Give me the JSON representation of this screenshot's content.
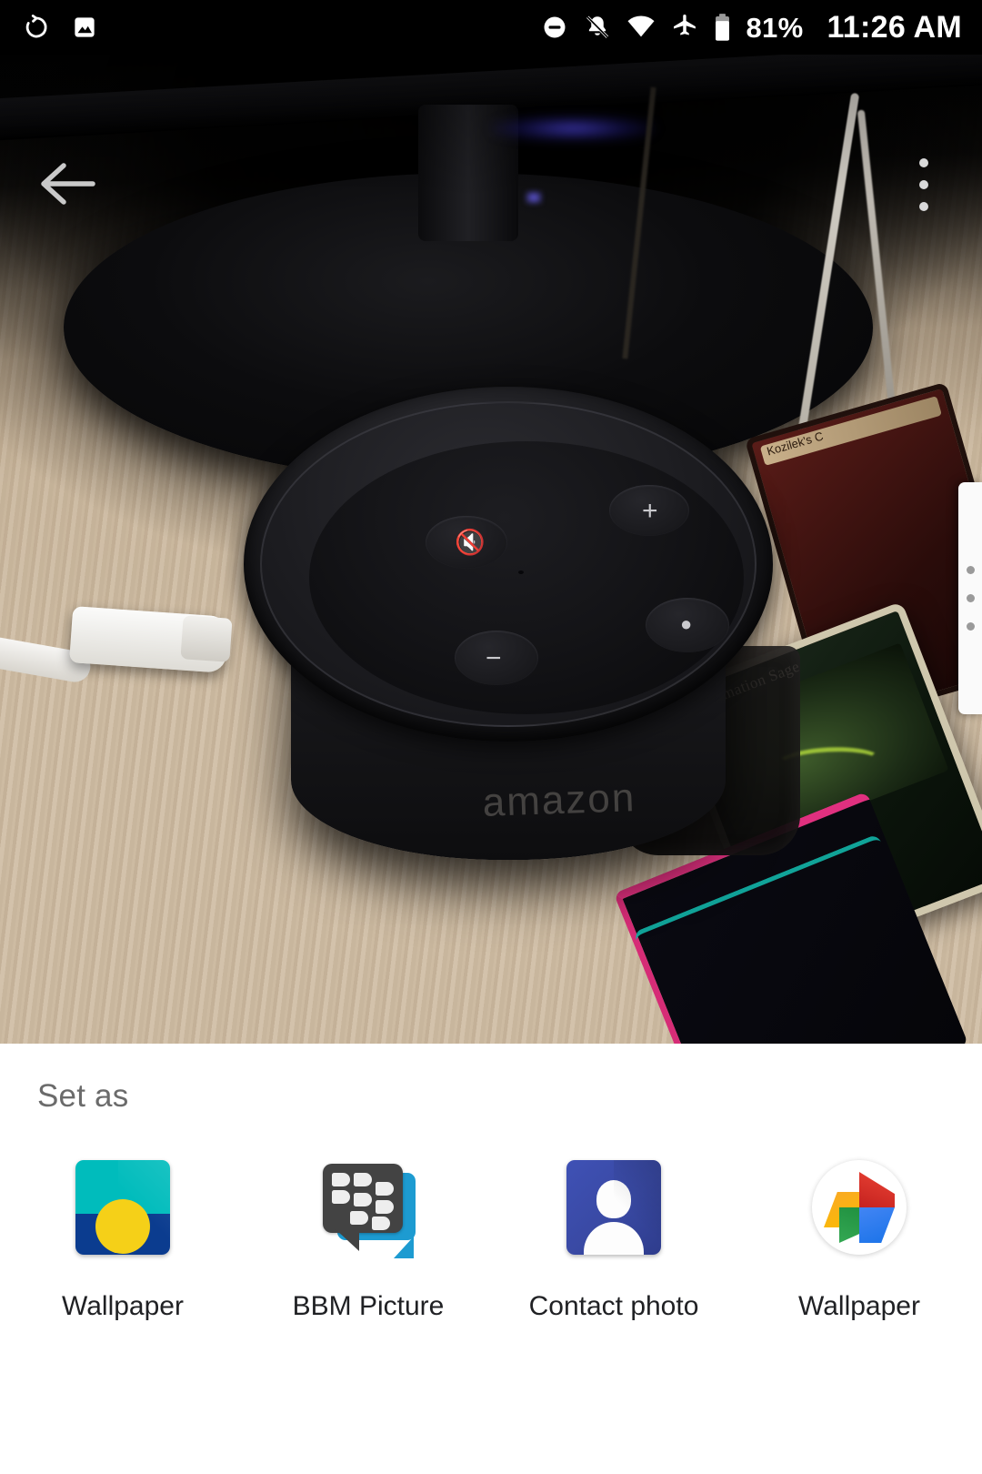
{
  "statusbar": {
    "left_icons": [
      {
        "name": "auto-rotate-icon",
        "glyph": "rotate"
      },
      {
        "name": "screenshot-image-icon",
        "glyph": "image"
      }
    ],
    "right_icons": [
      {
        "name": "do-not-disturb-icon",
        "glyph": "minus-circle"
      },
      {
        "name": "notifications-silenced-icon",
        "glyph": "bell-slash"
      },
      {
        "name": "wifi-icon",
        "glyph": "wifi"
      },
      {
        "name": "airplane-mode-icon",
        "glyph": "airplane"
      },
      {
        "name": "battery-icon",
        "glyph": "battery"
      }
    ],
    "battery_percent": "81%",
    "time": "11:26 AM"
  },
  "toolbar": {
    "back_label": "Back",
    "overflow_label": "More options"
  },
  "photo": {
    "description": "Amazon Echo Dot on a wooden desk with USB cable and Magic cards",
    "amazon_wordmark": "amazon",
    "card_red_name": "Kozilek's C",
    "card_green_name": "Reclamation Sage"
  },
  "sheet": {
    "title": "Set as",
    "targets": [
      {
        "label": "Wallpaper",
        "icon": "wallpaper-icon"
      },
      {
        "label": "BBM Picture",
        "icon": "bbm-icon"
      },
      {
        "label": "Contact photo",
        "icon": "contacts-icon"
      },
      {
        "label": "Wallpaper",
        "icon": "google-photos-icon"
      }
    ]
  },
  "colors": {
    "sheet_background": "#ffffff",
    "title_text": "#6b6b6b",
    "label_text": "#202124",
    "wallpaper_sky": "#00bcbc",
    "wallpaper_sea": "#0b3c8f",
    "wallpaper_sun": "#f5d018",
    "bbm_gray": "#434343",
    "bbm_blue": "#1d9bd1",
    "contacts_indigo": "#3f51b5",
    "photos_red": "#ea4335",
    "photos_yellow": "#fbbc04",
    "photos_green": "#34a853",
    "photos_blue": "#4285f4",
    "status_bar": "#000000"
  }
}
